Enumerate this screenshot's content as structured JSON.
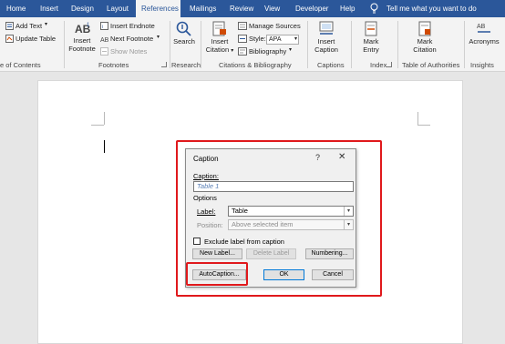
{
  "tabs": [
    "Home",
    "Insert",
    "Design",
    "Layout",
    "References",
    "Mailings",
    "Review",
    "View",
    "Developer",
    "Help"
  ],
  "active_tab": "References",
  "tell_me": "Tell me what you want to do",
  "ribbon": {
    "toc": {
      "add_text": "Add Text",
      "update_table": "Update Table",
      "group_label": "e of Contents"
    },
    "footnotes": {
      "insert_footnote": "Insert Footnote",
      "insert_endnote": "Insert Endnote",
      "next_footnote": "Next Footnote",
      "show_notes": "Show Notes",
      "group_label": "Footnotes"
    },
    "research": {
      "search": "Search",
      "group_label": "Research"
    },
    "citations": {
      "insert_citation": "Insert Citation",
      "manage_sources": "Manage Sources",
      "style_label": "Style:",
      "style_value": "APA",
      "bibliography": "Bibliography",
      "group_label": "Citations & Bibliography"
    },
    "captions": {
      "insert_caption": "Insert Caption",
      "group_label": "Captions"
    },
    "index": {
      "mark_entry": "Mark Entry",
      "group_label": "Index"
    },
    "authorities": {
      "mark_citation": "Mark Citation",
      "group_label": "Table of Authorities"
    },
    "insights": {
      "acronyms": "Acronyms",
      "group_label": "Insights"
    }
  },
  "dialog": {
    "title": "Caption",
    "help": "?",
    "close": "✕",
    "caption_label": "Caption:",
    "caption_value": "Table 1",
    "options_label": "Options",
    "label_label": "Label:",
    "label_value": "Table",
    "position_label": "Position:",
    "position_value": "Above selected item",
    "exclude_label": "Exclude label from caption",
    "exclude_checked": false,
    "new_label_btn": "New Label...",
    "delete_label_btn": "Delete Label",
    "numbering_btn": "Numbering...",
    "autocaption_btn": "AutoCaption...",
    "ok_btn": "OK",
    "cancel_btn": "Cancel"
  },
  "colors": {
    "tabbar": "#2b579a",
    "highlight": "#e0191c",
    "ribbon": "#f3f3f3"
  }
}
